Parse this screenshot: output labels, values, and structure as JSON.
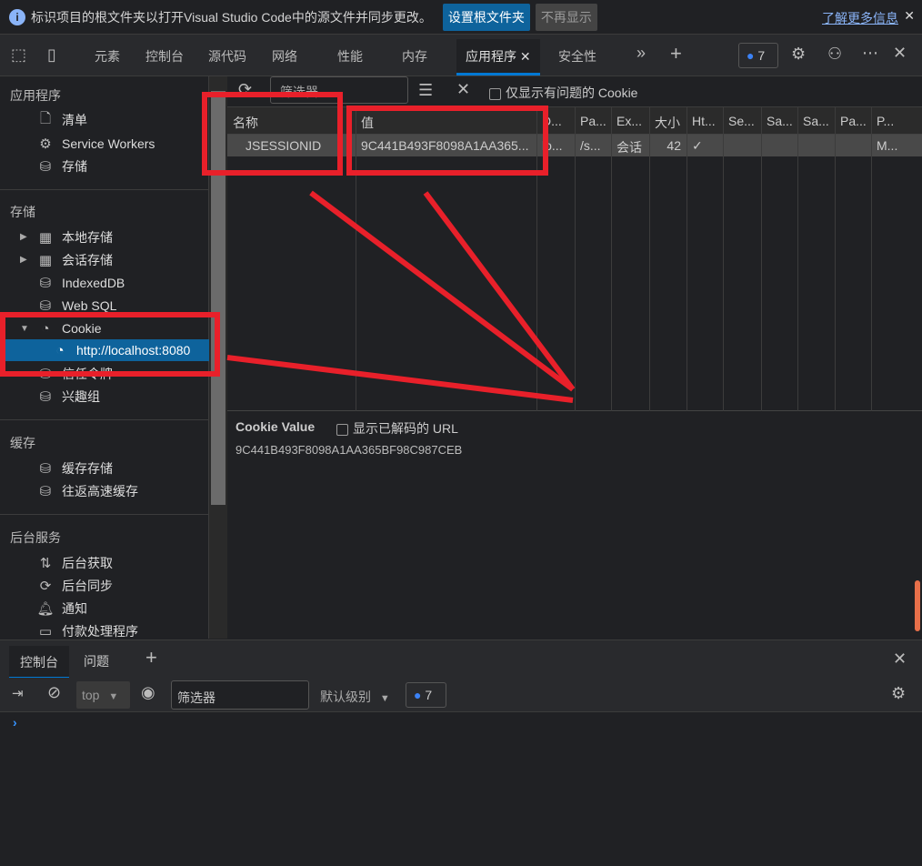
{
  "banner": {
    "message": "标识项目的根文件夹以打开Visual Studio Code中的源文件并同步更改。",
    "primary_button": "设置根文件夹",
    "secondary_button": "不再显示",
    "learn_more": "了解更多信息"
  },
  "tabs": [
    "元素",
    "控制台",
    "源代码",
    "网络",
    "性能",
    "内存",
    "应用程序",
    "安全性"
  ],
  "active_tab": "应用程序",
  "issues_count": "7",
  "sidebar": {
    "app_header": "应用程序",
    "app_items": [
      "清单",
      "Service Workers",
      "存储"
    ],
    "storage_header": "存储",
    "storage_items": [
      "本地存储",
      "会话存储",
      "IndexedDB",
      "Web SQL",
      "Cookie",
      "http://localhost:8080",
      "信任令牌",
      "兴趣组"
    ],
    "cache_header": "缓存",
    "cache_items": [
      "缓存存储",
      "往返高速缓存"
    ],
    "bg_header": "后台服务",
    "bg_items": [
      "后台获取",
      "后台同步",
      "通知",
      "付款处理程序"
    ]
  },
  "cookie_toolbar": {
    "filter_placeholder": "筛选器",
    "only_issues": "仅显示有问题的 Cookie"
  },
  "table": {
    "columns": [
      "名称",
      "值",
      "D...",
      "Pa...",
      "Ex...",
      "大小",
      "Ht...",
      "Se...",
      "Sa...",
      "Sa...",
      "Pa...",
      "P..."
    ],
    "rows": [
      [
        "JSESSIONID",
        "9C441B493F8098A1AA365...",
        "lo...",
        "/s...",
        "会话",
        "42",
        "✓",
        "",
        "",
        "",
        "",
        "M..."
      ]
    ]
  },
  "cookie_value": {
    "label": "Cookie Value",
    "decode_label": "显示已解码的 URL",
    "value": "9C441B493F8098A1AA365BF98C987CEB"
  },
  "drawer": {
    "tabs": [
      "控制台",
      "问题"
    ],
    "context": "top",
    "filter_placeholder": "筛选器",
    "level": "默认级别",
    "count": "7"
  },
  "colors": {
    "accent": "#0078d4",
    "annotation": "#e8202a",
    "selected": "#0e639c"
  }
}
